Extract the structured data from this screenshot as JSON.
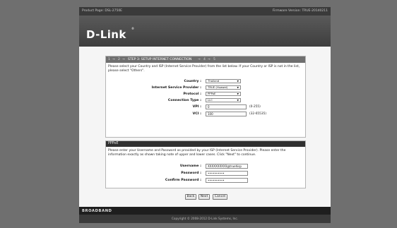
{
  "topbar": {
    "product_page": "Product Page: DSL-2750E",
    "firmware": "Firmware Version: TRUE-20140211"
  },
  "brand": {
    "logo": "D-Link",
    "reg": "®"
  },
  "wizard": {
    "steps": [
      "1",
      "2",
      "STEP 3: SETUP INTERNET CONNECTION",
      "4",
      "5"
    ],
    "separator": "→",
    "intro": "Please select your Country and ISP (Internet Service Provider) from the list below. If your Country or ISP is not in the list, please select \"Others\".",
    "fields": {
      "country": {
        "label": "Country :",
        "value": "Thailand"
      },
      "isp": {
        "label": "Internet Service Provider :",
        "value": "TRUE (Huawei)"
      },
      "protocol": {
        "label": "Protocol :",
        "value": "PPPoE"
      },
      "connection_type": {
        "label": "Connection Type :",
        "value": "LLC"
      },
      "vpi": {
        "label": "VPI :",
        "value": "0",
        "hint": "(0-255)"
      },
      "vci": {
        "label": "VCI :",
        "value": "100",
        "hint": "(32-65535)"
      }
    }
  },
  "pppoe": {
    "title": "PPPoE",
    "intro": "Please enter your Username and Password as provided by your ISP (Internet Service Provider). Please enter the information exactly as shown taking note of upper and lower cases. Click \"Next\" to continue.",
    "username": {
      "label": "Username :",
      "value": "XXXXXXXXXX@truehisp"
    },
    "password": {
      "label": "Password :",
      "value": "••••••••••"
    },
    "confirm_password": {
      "label": "Confirm Password :",
      "value": "••••••••••"
    }
  },
  "buttons": {
    "back": "Back",
    "next": "Next",
    "cancel": "Cancel"
  },
  "footer": {
    "brand": "BROADBAND",
    "copyright": "Copyright © 2008-2012 D-Link Systems, Inc."
  }
}
